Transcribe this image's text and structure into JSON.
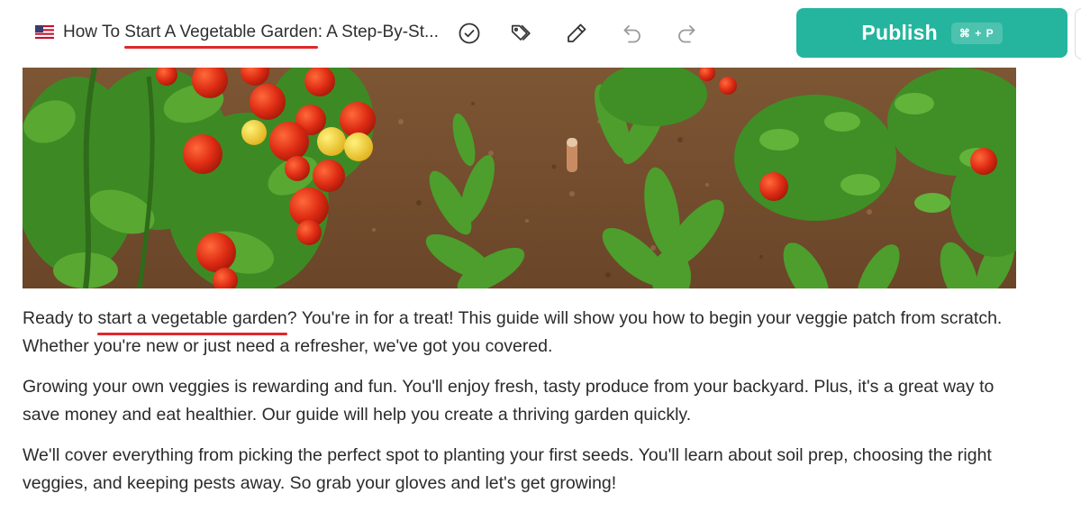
{
  "toolbar": {
    "flag_icon": "us-flag-icon",
    "title_prefix": "How To ",
    "title_keyword": "Start A Vegetable Garden",
    "title_suffix": ": A Step-By-St...",
    "icons": [
      "check-circle-icon",
      "tags-icon",
      "pencil-icon",
      "undo-icon",
      "redo-icon"
    ],
    "publish_label": "Publish",
    "publish_shortcut": "⌘ + P"
  },
  "article": {
    "hero_image": "vegetable-garden-photo",
    "p1_before": "Ready to ",
    "p1_keyword": "start a vegetable garden",
    "p1_after": "? You're in for a treat! This guide will show you how to begin your veggie patch from scratch. Whether you're new or just need a refresher, we've got you covered.",
    "p2": "Growing your own veggies is rewarding and fun. You'll enjoy fresh, tasty produce from your backyard. Plus, it's a great way to save money and eat healthier. Our guide will help you create a thriving garden quickly.",
    "p3": "We'll cover everything from picking the perfect spot to planting your first seeds. You'll learn about soil prep, choosing the right veggies, and keeping pests away. So grab your gloves and let's get growing!"
  },
  "colors": {
    "accent": "#25b59e",
    "keyword_underline": "#e0262b",
    "text": "#2b2b2b"
  }
}
